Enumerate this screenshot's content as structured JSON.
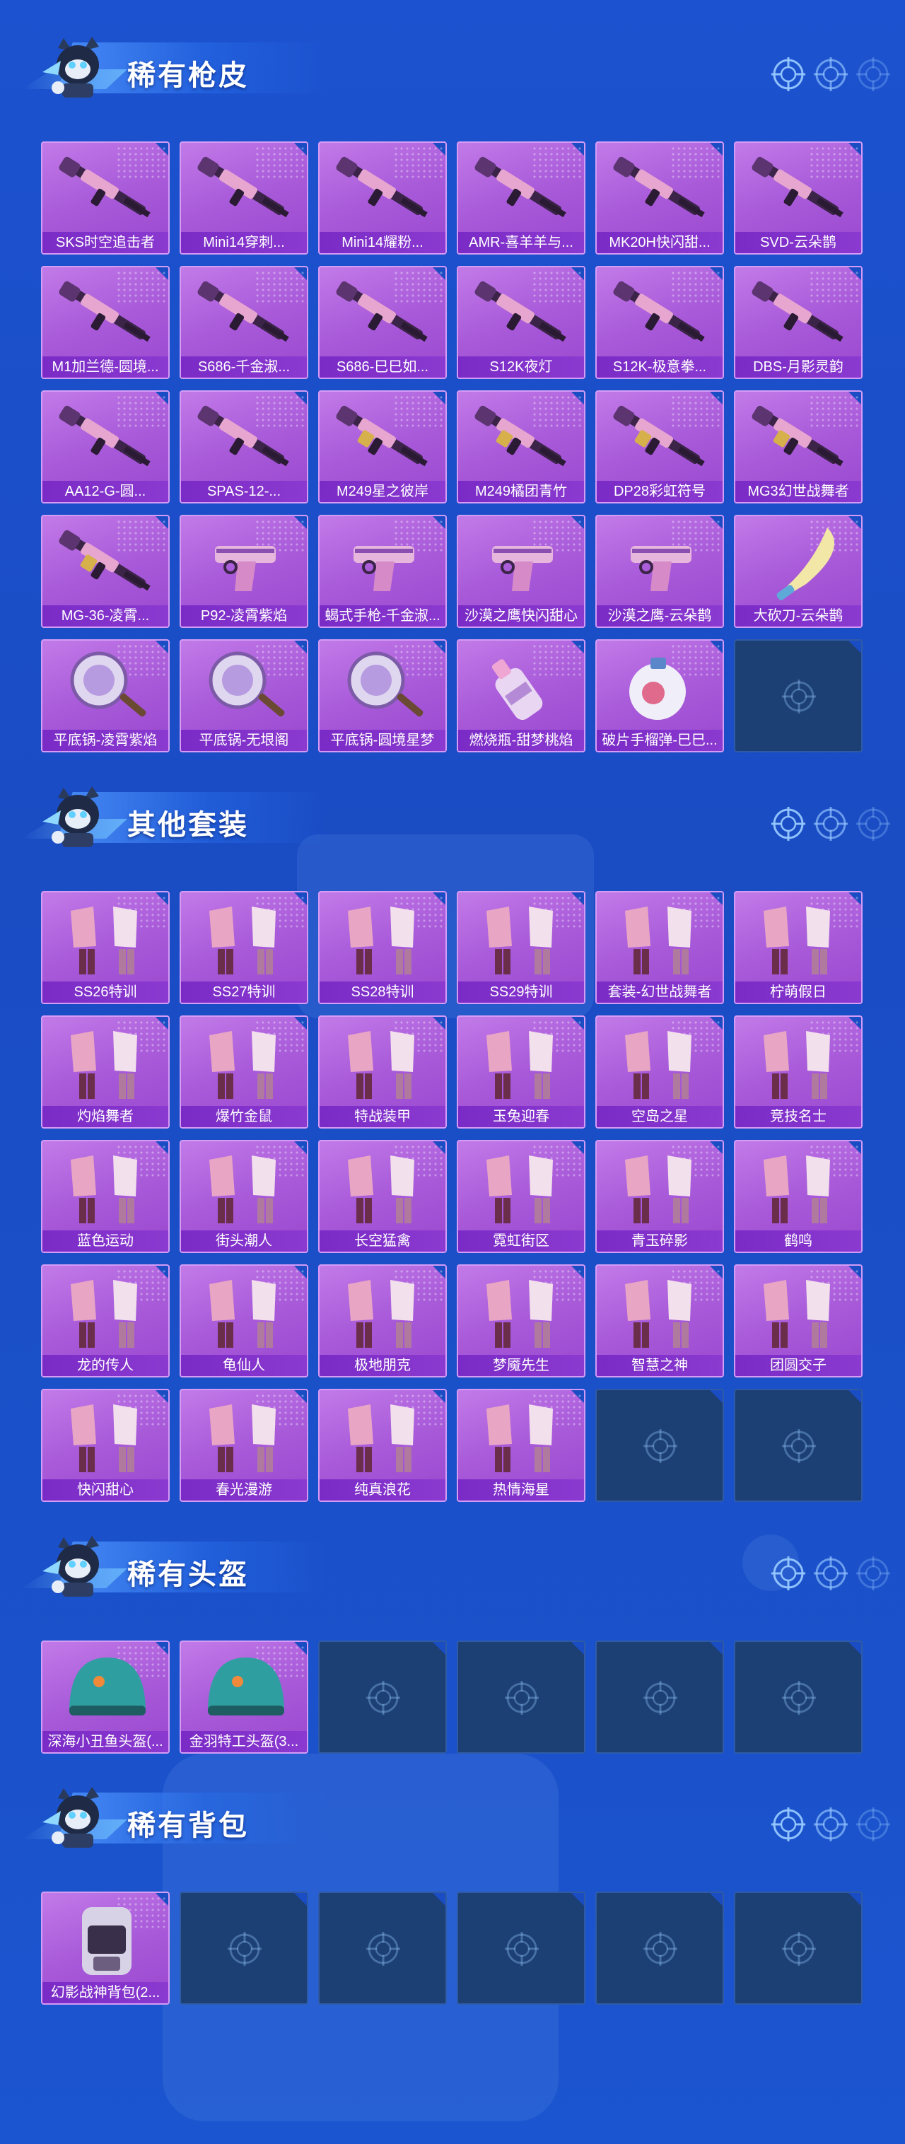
{
  "sections": [
    {
      "title": "稀有枪皮",
      "items": [
        {
          "label": "SKS时空追击者",
          "kind": "rifle"
        },
        {
          "label": "Mini14穿刺...",
          "kind": "rifle"
        },
        {
          "label": "Mini14耀粉...",
          "kind": "rifle"
        },
        {
          "label": "AMR-喜羊羊与...",
          "kind": "rifle"
        },
        {
          "label": "MK20H快闪甜...",
          "kind": "rifle"
        },
        {
          "label": "SVD-云朵鹊",
          "kind": "rifle"
        },
        {
          "label": "M1加兰德-圆境...",
          "kind": "rifle"
        },
        {
          "label": "S686-千金淑...",
          "kind": "shotgun"
        },
        {
          "label": "S686-巳巳如...",
          "kind": "shotgun"
        },
        {
          "label": "S12K夜灯",
          "kind": "rifle"
        },
        {
          "label": "S12K-极意拳...",
          "kind": "rifle"
        },
        {
          "label": "DBS-月影灵韵",
          "kind": "rifle"
        },
        {
          "label": "AA12-G-圆...",
          "kind": "rifle"
        },
        {
          "label": "SPAS-12-...",
          "kind": "shotgun"
        },
        {
          "label": "M249星之彼岸",
          "kind": "lmg"
        },
        {
          "label": "M249橘团青竹",
          "kind": "lmg"
        },
        {
          "label": "DP28彩虹符号",
          "kind": "lmg"
        },
        {
          "label": "MG3幻世战舞者",
          "kind": "lmg"
        },
        {
          "label": "MG-36-凌霄...",
          "kind": "lmg"
        },
        {
          "label": "P92-凌霄紫焰",
          "kind": "pistol"
        },
        {
          "label": "蝎式手枪-千金淑...",
          "kind": "pistol"
        },
        {
          "label": "沙漠之鹰快闪甜心",
          "kind": "pistol"
        },
        {
          "label": "沙漠之鹰-云朵鹊",
          "kind": "pistol"
        },
        {
          "label": "大砍刀-云朵鹊",
          "kind": "machete"
        },
        {
          "label": "平底锅-凌霄紫焰",
          "kind": "pan"
        },
        {
          "label": "平底锅-无垠阁",
          "kind": "pan"
        },
        {
          "label": "平底锅-圆境星梦",
          "kind": "pan"
        },
        {
          "label": "燃烧瓶-甜梦桃焰",
          "kind": "bottle"
        },
        {
          "label": "破片手榴弹-巳巳...",
          "kind": "grenade"
        },
        {
          "label": "",
          "kind": "empty"
        }
      ]
    },
    {
      "title": "其他套装",
      "items": [
        {
          "label": "SS26特训",
          "kind": "outfit"
        },
        {
          "label": "SS27特训",
          "kind": "outfit"
        },
        {
          "label": "SS28特训",
          "kind": "outfit"
        },
        {
          "label": "SS29特训",
          "kind": "outfit"
        },
        {
          "label": "套装-幻世战舞者",
          "kind": "outfit"
        },
        {
          "label": "柠萌假日",
          "kind": "outfit"
        },
        {
          "label": "灼焰舞者",
          "kind": "outfit"
        },
        {
          "label": "爆竹金鼠",
          "kind": "outfit"
        },
        {
          "label": "特战装甲",
          "kind": "outfit"
        },
        {
          "label": "玉兔迎春",
          "kind": "outfit"
        },
        {
          "label": "空岛之星",
          "kind": "outfit"
        },
        {
          "label": "竞技名士",
          "kind": "outfit"
        },
        {
          "label": "蓝色运动",
          "kind": "outfit"
        },
        {
          "label": "街头潮人",
          "kind": "outfit"
        },
        {
          "label": "长空猛禽",
          "kind": "outfit"
        },
        {
          "label": "霓虹街区",
          "kind": "outfit"
        },
        {
          "label": "青玉碎影",
          "kind": "outfit"
        },
        {
          "label": "鹤鸣",
          "kind": "outfit"
        },
        {
          "label": "龙的传人",
          "kind": "outfit"
        },
        {
          "label": "龟仙人",
          "kind": "outfit"
        },
        {
          "label": "极地朋克",
          "kind": "outfit"
        },
        {
          "label": "梦魇先生",
          "kind": "outfit"
        },
        {
          "label": "智慧之神",
          "kind": "outfit"
        },
        {
          "label": "团圆交子",
          "kind": "outfit"
        },
        {
          "label": "快闪甜心",
          "kind": "outfit"
        },
        {
          "label": "春光漫游",
          "kind": "outfit"
        },
        {
          "label": "纯真浪花",
          "kind": "outfit"
        },
        {
          "label": "热情海星",
          "kind": "outfit"
        },
        {
          "label": "",
          "kind": "empty"
        },
        {
          "label": "",
          "kind": "empty"
        }
      ]
    },
    {
      "title": "稀有头盔",
      "items": [
        {
          "label": "深海小丑鱼头盔(...",
          "kind": "helmet"
        },
        {
          "label": "金羽特工头盔(3...",
          "kind": "helmet"
        },
        {
          "label": "",
          "kind": "empty"
        },
        {
          "label": "",
          "kind": "empty"
        },
        {
          "label": "",
          "kind": "empty"
        },
        {
          "label": "",
          "kind": "empty"
        }
      ]
    },
    {
      "title": "稀有背包",
      "items": [
        {
          "label": "幻影战神背包(2...",
          "kind": "backpack"
        },
        {
          "label": "",
          "kind": "empty"
        },
        {
          "label": "",
          "kind": "empty"
        },
        {
          "label": "",
          "kind": "empty"
        },
        {
          "label": "",
          "kind": "empty"
        },
        {
          "label": "",
          "kind": "empty"
        }
      ]
    }
  ],
  "icons": {
    "header_right": [
      "target-icon",
      "target-icon",
      "target-icon"
    ],
    "empty_slot": "target-icon",
    "header_mascot": "mascot-icon"
  },
  "colors": {
    "background": "#1c52cf",
    "card_fill": "#b265de",
    "card_label_bar": "#7a2bc6",
    "empty_slot": "#1c3f74"
  }
}
